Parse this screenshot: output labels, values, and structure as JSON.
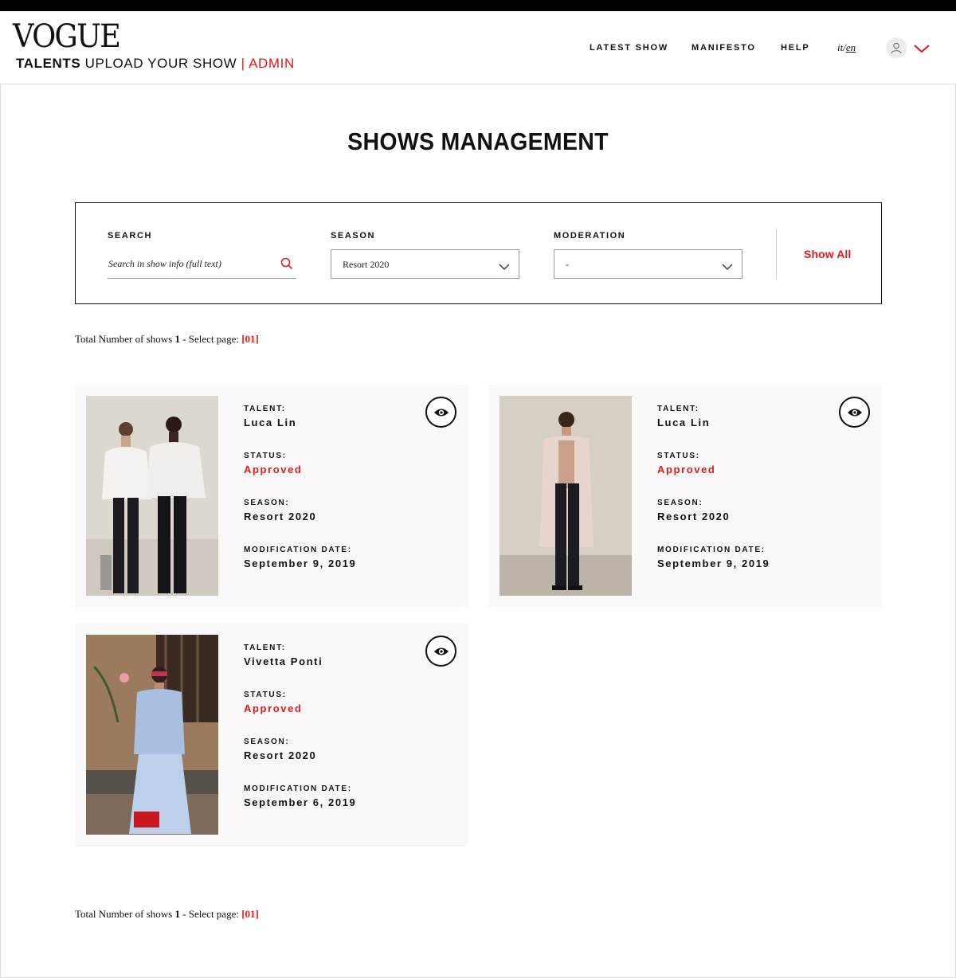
{
  "header": {
    "logo": "VOGUE",
    "subtitle_bold": "TALENTS",
    "subtitle_rest": "UPLOAD YOUR SHOW",
    "separator": "|",
    "admin": "ADMIN",
    "nav": [
      "LATEST SHOW",
      "MANIFESTO",
      "HELP"
    ],
    "lang_it": "it",
    "lang_sep": "/",
    "lang_en": "en",
    "user_icon": "user-icon",
    "menu_icon": "chevron-down-icon"
  },
  "page": {
    "title": "SHOWS MANAGEMENT"
  },
  "filters": {
    "search_label": "SEARCH",
    "search_placeholder": "Search in show info (full text)",
    "season_label": "SEASON",
    "season_value": "Resort 2020",
    "moderation_label": "MODERATION",
    "moderation_value": "-",
    "show_all": "Show All"
  },
  "summary": {
    "text": "Total Number of shows",
    "count": "1",
    "select_text": "- Select page:",
    "page": "[01]"
  },
  "labels": {
    "talent": "TALENT:",
    "status": "STATUS:",
    "season": "SEASON:",
    "modification_date": "MODIFICATION DATE:"
  },
  "shows": [
    {
      "talent": "Luca Lin",
      "status": "Approved",
      "season": "Resort 2020",
      "modification_date": "September 9, 2019"
    },
    {
      "talent": "Luca Lin",
      "status": "Approved",
      "season": "Resort 2020",
      "modification_date": "September 9, 2019"
    },
    {
      "talent": "Vivetta Ponti",
      "status": "Approved",
      "season": "Resort 2020",
      "modification_date": "September 6, 2019"
    }
  ],
  "colors": {
    "accent": "#e11a1a",
    "card_bg": "#faf8f8",
    "text": "#111111"
  }
}
